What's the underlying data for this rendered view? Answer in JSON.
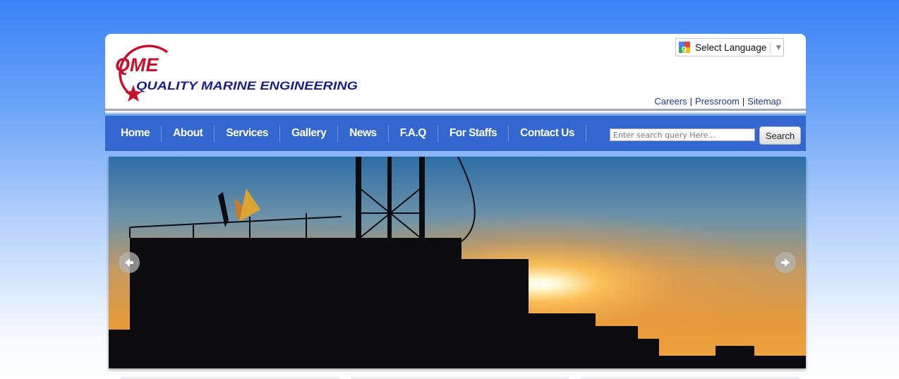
{
  "brand": {
    "logo_mark": "QME",
    "logo_name": "QUALITY MARINE ENGINEERING",
    "primary_color": "#c8102e",
    "secondary_color": "#1b1f8a"
  },
  "language": {
    "label": "Select Language",
    "icon": "google-translate-icon"
  },
  "toplinks": {
    "careers": "Careers",
    "pressroom": "Pressroom",
    "sitemap": "Sitemap",
    "separator": "|"
  },
  "nav": {
    "items": [
      "Home",
      "About",
      "Services",
      "Gallery",
      "News",
      "F.A.Q",
      "For Staffs",
      "Contact Us"
    ],
    "color": "#3367cf"
  },
  "search": {
    "placeholder": "Enter search query Here...",
    "button_label": "Search"
  },
  "slider": {
    "prev_icon": "arrow-left-icon",
    "next_icon": "arrow-right-icon",
    "scene": "oil-rig-sunset"
  }
}
